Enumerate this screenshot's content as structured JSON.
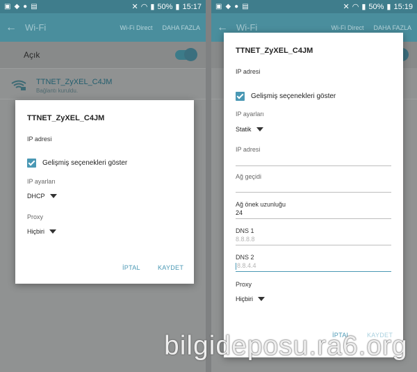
{
  "status_left": {
    "battery": "50%",
    "time": "15:17"
  },
  "status_right": {
    "battery": "50%",
    "time": "15:19"
  },
  "actionbar": {
    "title": "Wi-Fi",
    "wifi_direct": "Wi-Fi Direct",
    "more": "DAHA FAZLA"
  },
  "toggle_label": "Açık",
  "network": {
    "name": "TTNET_ZyXEL_C4JM",
    "status": "Bağlantı kuruldu."
  },
  "dialog_left": {
    "title": "TTNET_ZyXEL_C4JM",
    "ip_section": "IP adresi",
    "advanced_label": "Gelişmiş seçenekleri göster",
    "ip_settings_label": "IP ayarları",
    "ip_settings_value": "DHCP",
    "proxy_label": "Proxy",
    "proxy_value": "Hiçbiri",
    "cancel": "İPTAL",
    "save": "KAYDET"
  },
  "dialog_right": {
    "title": "TTNET_ZyXEL_C4JM",
    "ip_section": "IP adresi",
    "advanced_label": "Gelişmiş seçenekleri göster",
    "ip_settings_label": "IP ayarları",
    "ip_settings_value": "Statik",
    "ip_address_label": "IP adresi",
    "ip_address_value": "",
    "gateway_label": "Ağ geçidi",
    "gateway_value": "",
    "prefix_label": "Ağ önek uzunluğu",
    "prefix_value": "24",
    "dns1_label": "DNS 1",
    "dns1_placeholder": "8.8.8.8",
    "dns2_label": "DNS 2",
    "dns2_placeholder": "8.8.4.4",
    "proxy_label": "Proxy",
    "proxy_value": "Hiçbiri",
    "cancel": "İPTAL",
    "save": "KAYDET"
  },
  "watermark": "bilgideposu.ra6.org",
  "colors": {
    "accent": "#4a98b4",
    "actionbar": "#4a8e9d",
    "statusbar": "#3f7d8c"
  }
}
